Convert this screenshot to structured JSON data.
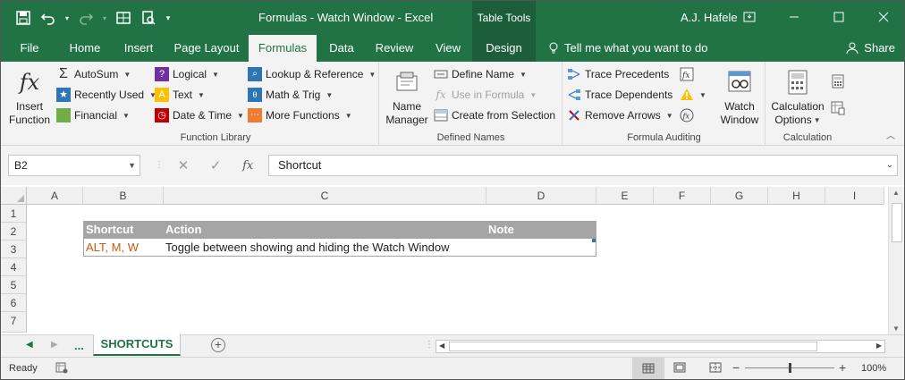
{
  "window": {
    "title": "Formulas - Watch Window - Excel",
    "context_tab": "Table Tools",
    "user": "A.J. Hafele"
  },
  "tabs": [
    "File",
    "Home",
    "Insert",
    "Page Layout",
    "Formulas",
    "Data",
    "Review",
    "View",
    "Design"
  ],
  "tell_me": "Tell me what you want to do",
  "share": "Share",
  "ribbon": {
    "insert_function": {
      "line1": "Insert",
      "line2": "Function"
    },
    "function_library": {
      "label": "Function Library",
      "autosum": "AutoSum",
      "recently_used": "Recently Used",
      "financial": "Financial",
      "logical": "Logical",
      "text": "Text",
      "date_time": "Date & Time",
      "lookup_reference": "Lookup & Reference",
      "math_trig": "Math & Trig",
      "more_functions": "More Functions"
    },
    "defined_names": {
      "label": "Defined Names",
      "name_manager": {
        "line1": "Name",
        "line2": "Manager"
      },
      "define_name": "Define Name",
      "use_in_formula": "Use in Formula",
      "create_from_selection": "Create from Selection"
    },
    "formula_auditing": {
      "label": "Formula Auditing",
      "trace_precedents": "Trace Precedents",
      "trace_dependents": "Trace Dependents",
      "remove_arrows": "Remove Arrows",
      "watch_window": {
        "line1": "Watch",
        "line2": "Window"
      }
    },
    "calculation": {
      "label": "Calculation",
      "calculation_options": {
        "line1": "Calculation",
        "line2": "Options"
      }
    }
  },
  "formula_bar": {
    "name_box": "B2",
    "fx": "fx",
    "content": "Shortcut"
  },
  "grid": {
    "columns": [
      "A",
      "B",
      "C",
      "D",
      "E",
      "F",
      "G",
      "H",
      "I"
    ],
    "rows": [
      "1",
      "2",
      "3",
      "4",
      "5",
      "6",
      "7"
    ],
    "table_headers": {
      "shortcut": "Shortcut",
      "action": "Action",
      "note": "Note"
    },
    "table_row": {
      "shortcut": "ALT, M, W",
      "action": "Toggle between showing and hiding the Watch Window",
      "note": ""
    }
  },
  "sheets": {
    "ellipsis": "...",
    "active": "SHORTCUTS"
  },
  "status": {
    "ready": "Ready",
    "zoom": "100%"
  },
  "colors": {
    "excel_green": "#217346",
    "table_header": "#a5a5a5",
    "shortcut_text": "#c65911"
  }
}
